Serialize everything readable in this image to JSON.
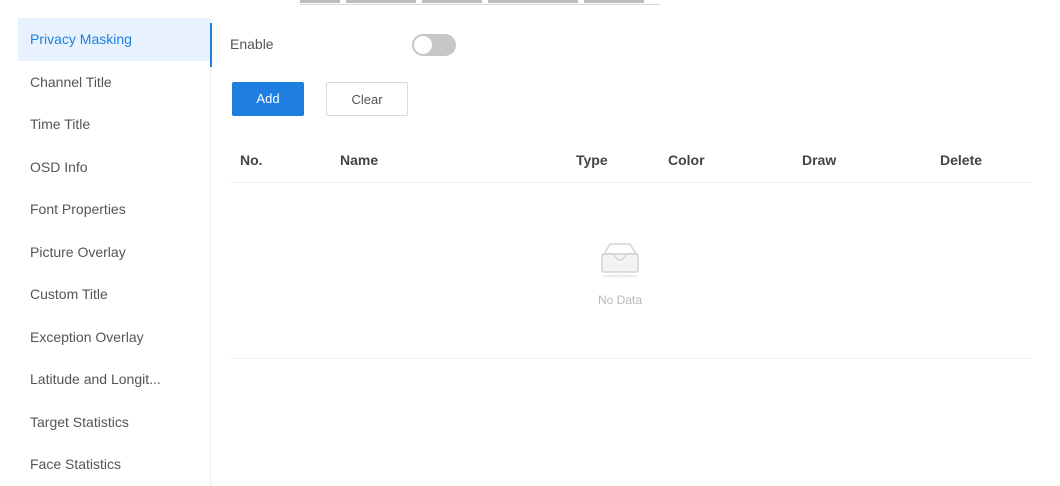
{
  "sidebar": {
    "items": [
      {
        "label": "Privacy Masking",
        "active": true
      },
      {
        "label": "Channel Title"
      },
      {
        "label": "Time Title"
      },
      {
        "label": "OSD Info"
      },
      {
        "label": "Font Properties"
      },
      {
        "label": "Picture Overlay"
      },
      {
        "label": "Custom Title"
      },
      {
        "label": "Exception Overlay"
      },
      {
        "label": "Latitude and Longit..."
      },
      {
        "label": "Target Statistics"
      },
      {
        "label": "Face Statistics"
      }
    ]
  },
  "main": {
    "enable_label": "Enable",
    "enable_on": false,
    "add_label": "Add",
    "clear_label": "Clear",
    "table": {
      "columns": [
        "No.",
        "Name",
        "Type",
        "Color",
        "Draw",
        "Delete"
      ]
    },
    "empty_text": "No Data"
  },
  "colors": {
    "accent": "#1e7fe0",
    "active_bg": "#e8f2ff",
    "toggle_off": "#c6c6c6"
  }
}
